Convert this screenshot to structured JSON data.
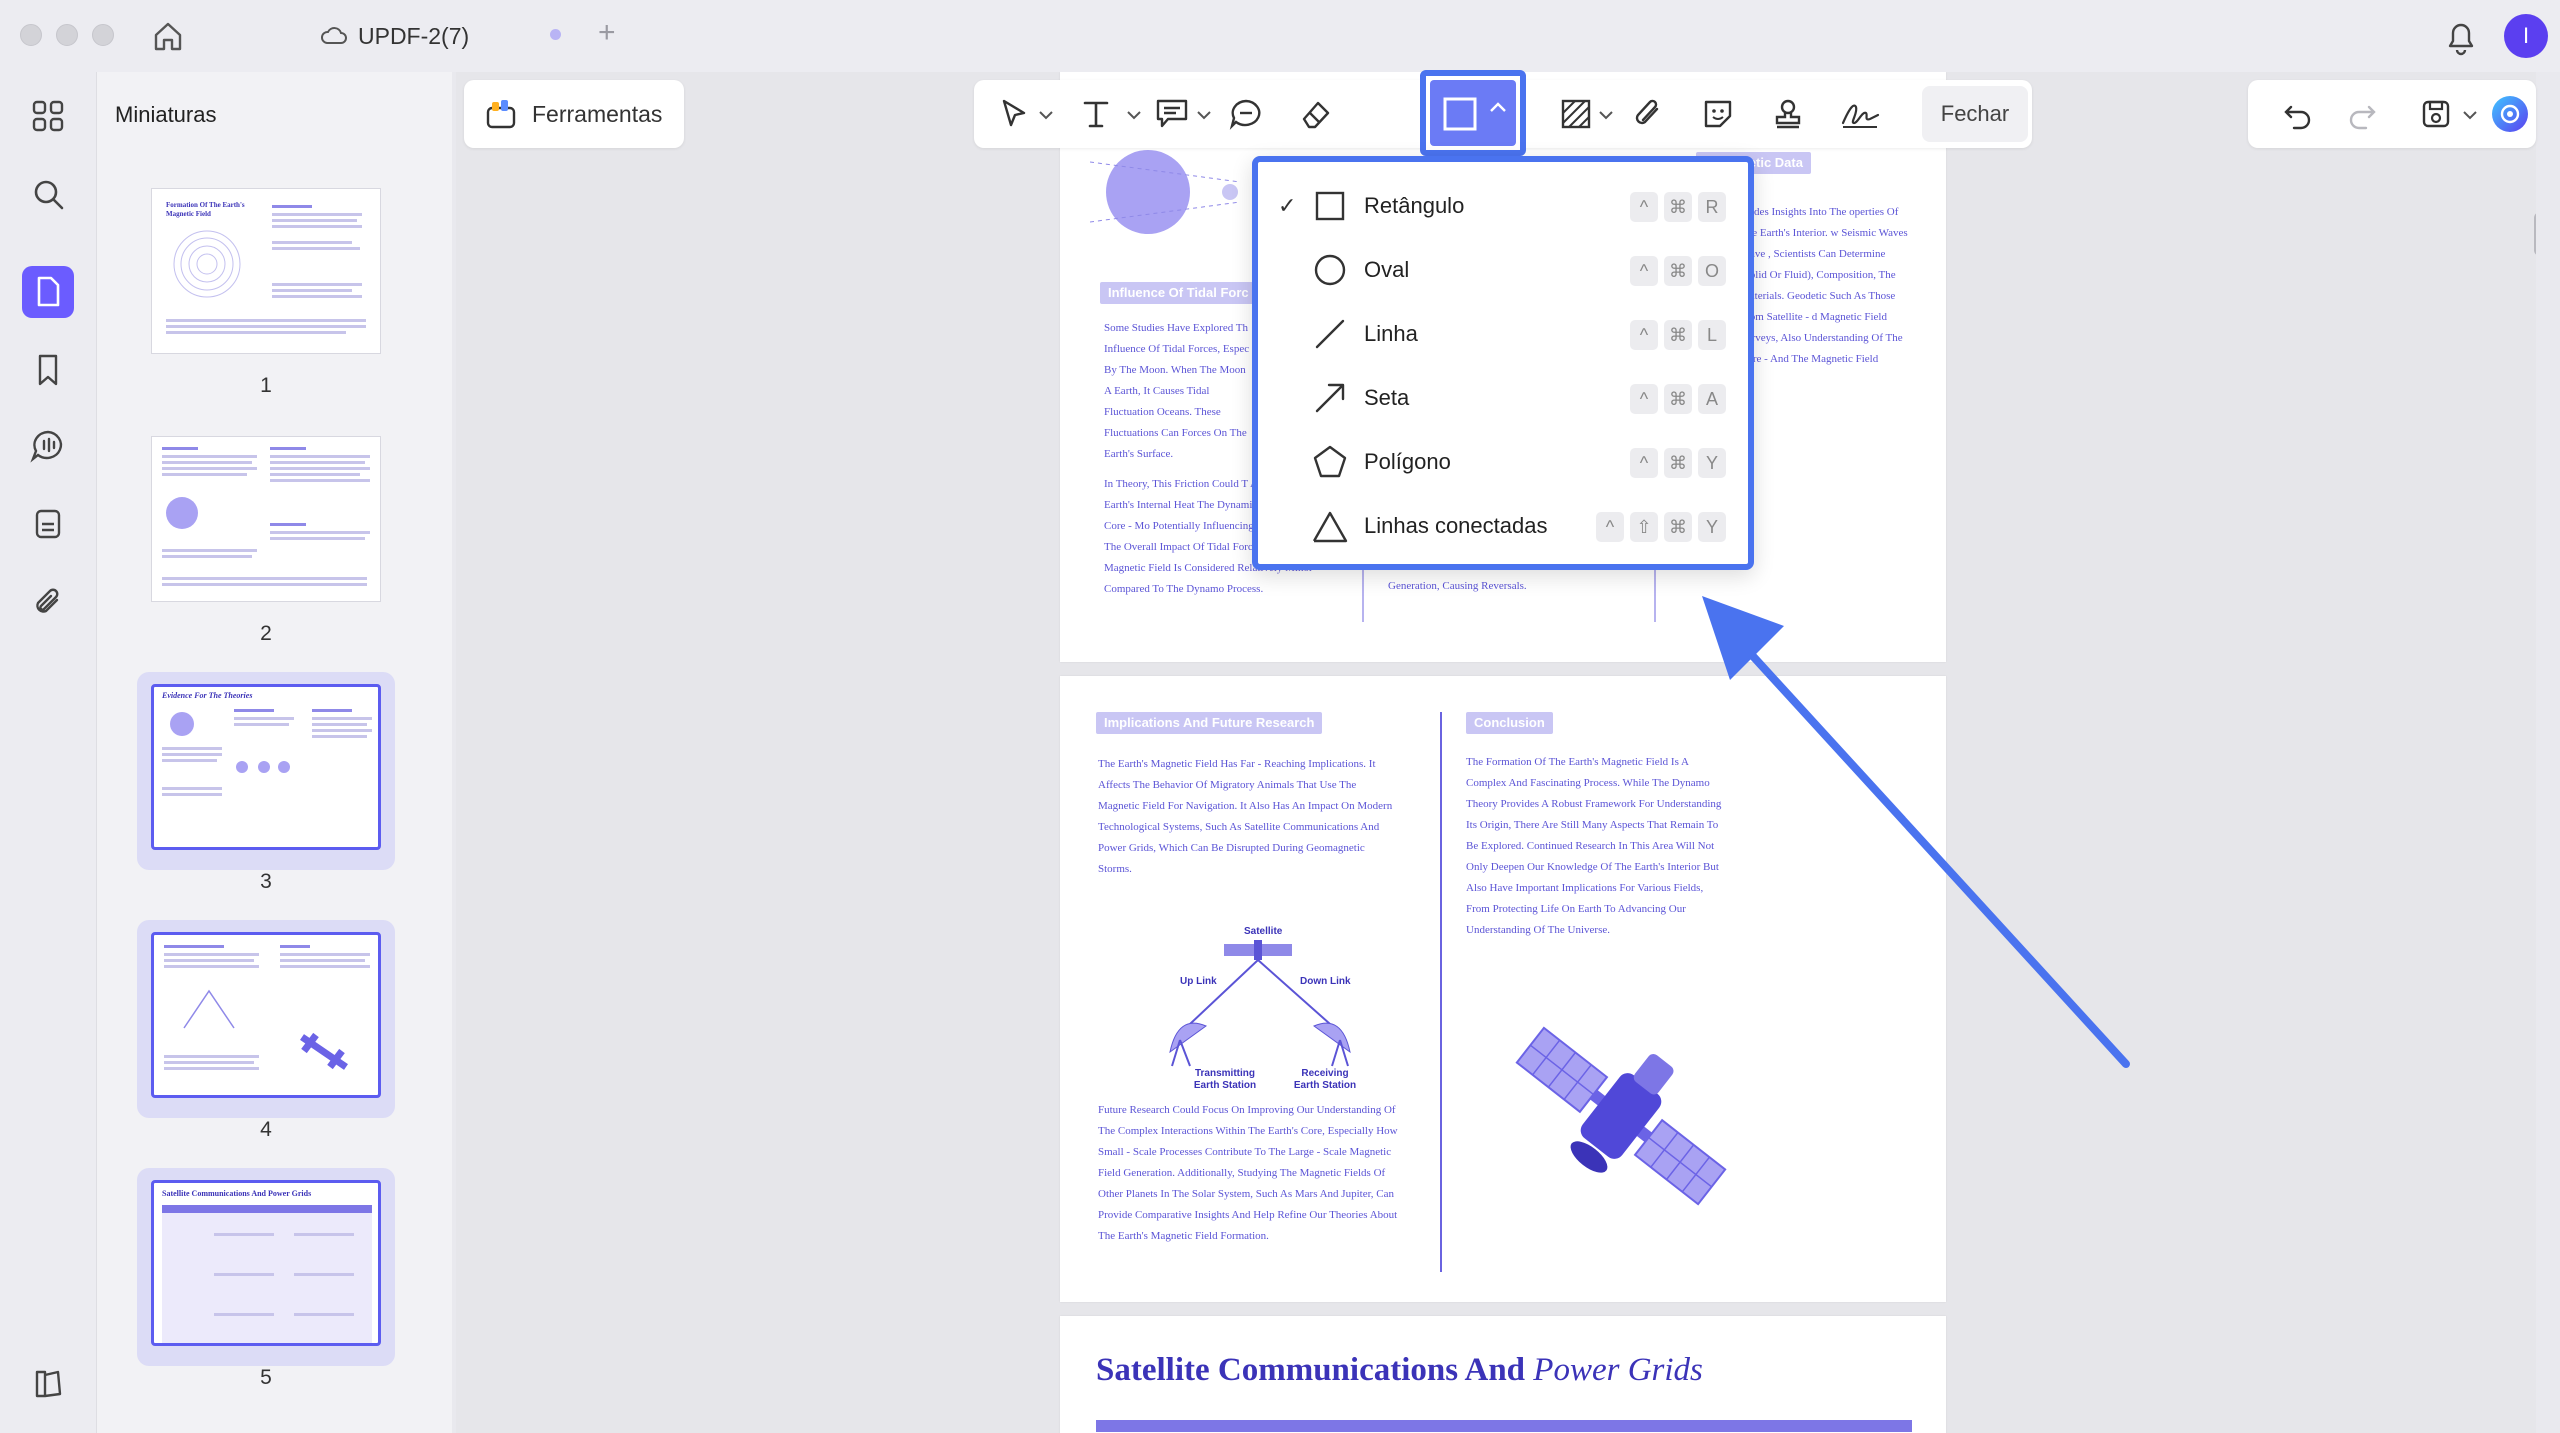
{
  "window": {
    "tab_title": "UPDF-2(7)",
    "avatar_initial": "I"
  },
  "sidebar": {
    "title": "Miniaturas",
    "pages": [
      {
        "number": "1",
        "title": "Formation Of The Earth's Magnetic Field"
      },
      {
        "number": "2"
      },
      {
        "number": "3",
        "title": "Evidence For The Theories"
      },
      {
        "number": "4"
      },
      {
        "number": "5",
        "title": "Satellite Communications And Power Grids"
      }
    ]
  },
  "toolbar": {
    "tools_label": "Ferramentas",
    "close_label": "Fechar"
  },
  "shape_menu": {
    "items": [
      {
        "label": "Retângulo",
        "checked": true,
        "keys": [
          "^",
          "⌘",
          "R"
        ]
      },
      {
        "label": "Oval",
        "checked": false,
        "keys": [
          "^",
          "⌘",
          "O"
        ]
      },
      {
        "label": "Linha",
        "checked": false,
        "keys": [
          "^",
          "⌘",
          "L"
        ]
      },
      {
        "label": "Seta",
        "checked": false,
        "keys": [
          "^",
          "⌘",
          "A"
        ]
      },
      {
        "label": "Polígono",
        "checked": false,
        "keys": [
          "^",
          "⌘",
          "Y"
        ]
      },
      {
        "label": "Linhas conectadas",
        "checked": false,
        "keys": [
          "^",
          "⇧",
          "⌘",
          "Y"
        ]
      }
    ]
  },
  "document": {
    "page3": {
      "tidal_label": "Influence Of Tidal Forc",
      "geodetic_label": "d Geodetic Data",
      "tidal_p1": "Some Studies Have Explored Th Influence Of Tidal Forces, Espec By The Moon. When The Moon A Earth, It Causes Tidal Fluctuation Oceans. These Fluctuations Can Forces On The Earth's Surface.",
      "tidal_p2": "In Theory, This Friction Could T Affect The Earth's Internal Heat The Dynamics Of The Core - Mo Potentially Influencing The Magn The Overall Impact Of Tidal Forces On The Magnetic Field Is Considered Relatively Minor Compared To The Dynamo Process.",
      "geo_p": "ovides Insights Into The operties Of The Earth's Interior. w Seismic Waves Trave , Scientists Can Determine (Solid Or Fluid), Composition, The Materials. Geodetic Such As Those From Satellite - d Magnetic Field Surveys, Also Understanding Of The Core - And The Magnetic Field",
      "mid_p": "Generation, Causing Reversals."
    },
    "page4": {
      "left_label": "Implications And Future Research",
      "right_label": "Conclusion",
      "left_p1": "The Earth's Magnetic Field Has Far - Reaching Implications. It Affects The Behavior Of Migratory Animals That Use The Magnetic Field For Navigation. It Also Has An Impact On Modern Technological Systems, Such As Satellite Communications And Power Grids, Which Can Be Disrupted During Geomagnetic Storms.",
      "left_p2": "Future Research Could Focus On Improving Our Understanding Of The Complex Interactions Within The Earth's Core, Especially How Small - Scale Processes Contribute To The Large - Scale Magnetic Field Generation. Additionally, Studying The Magnetic Fields Of Other Planets In The Solar System, Such As Mars And Jupiter, Can Provide Comparative Insights And Help Refine Our Theories About The Earth's Magnetic Field Formation.",
      "right_p": "The Formation Of The Earth's Magnetic Field Is A Complex And Fascinating Process. While The Dynamo Theory Provides A Robust Framework For Understanding Its Origin, There Are Still Many Aspects That Remain To Be Explored. Continued Research In This Area Will Not Only Deepen Our Knowledge Of The Earth's Interior But Also Have Important Implications For Various Fields, From Protecting Life On Earth To Advancing Our Understanding Of The Universe.",
      "diagram": {
        "satellite": "Satellite",
        "uplink": "Up Link",
        "downlink": "Down Link",
        "tx1": "Transmitting",
        "tx2": "Earth Station",
        "rx1": "Receiving",
        "rx2": "Earth Station"
      }
    },
    "page5": {
      "title_main": "Satellite Communications And ",
      "title_italic": "Power Grids"
    }
  },
  "colors": {
    "accent": "#4a73ef",
    "brand": "#6b5cff",
    "doc_text": "#5b54d6"
  }
}
